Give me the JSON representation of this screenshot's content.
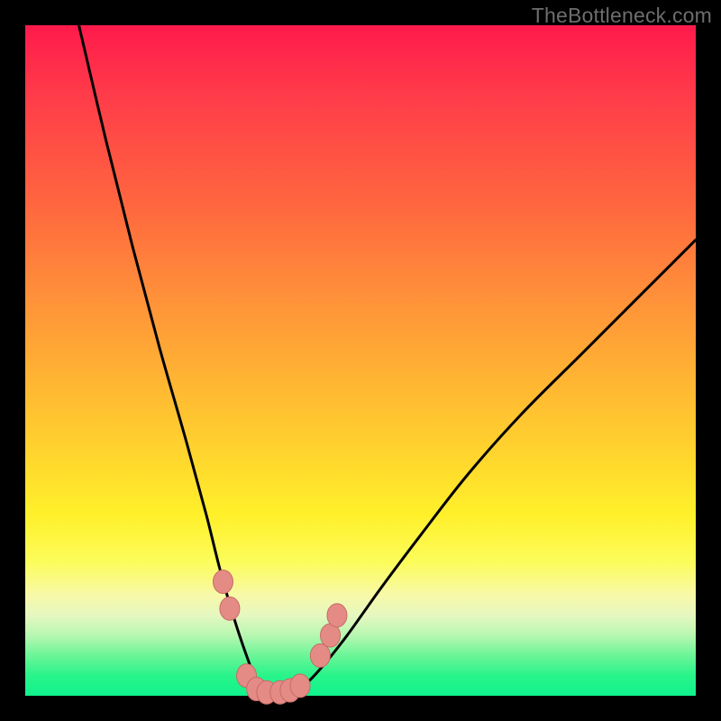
{
  "watermark": "TheBottleneck.com",
  "colors": {
    "curve_stroke": "#000000",
    "marker_fill": "#e58b86",
    "marker_stroke": "#c46c67",
    "background_black": "#000000"
  },
  "chart_data": {
    "type": "line",
    "title": "",
    "xlabel": "",
    "ylabel": "",
    "xlim": [
      0,
      100
    ],
    "ylim": [
      0,
      100
    ],
    "grid": false,
    "note": "No numeric axes or tick labels are rendered in the source image; x/y are normalized 0–100 across the plot rectangle, y measured from bottom. Curve is a V-shaped bottleneck curve with minimum near x≈35 touching y≈0; left branch rises to y≈100 near x≈8, right branch rises to y≈68 at x=100.",
    "series": [
      {
        "name": "bottleneck-curve",
        "x": [
          8,
          12,
          16,
          20,
          24,
          27,
          29,
          31,
          33,
          35,
          37,
          39,
          41,
          44,
          48,
          53,
          59,
          66,
          74,
          83,
          92,
          100
        ],
        "values": [
          100,
          83,
          67,
          52,
          38,
          27,
          19,
          12,
          6,
          1,
          0,
          0,
          1,
          4,
          9,
          16,
          24,
          33,
          42,
          51,
          60,
          68
        ]
      }
    ],
    "markers": {
      "name": "highlighted-points",
      "note": "Pink lozenge markers clustered around the trough of the curve.",
      "points": [
        {
          "x": 29.5,
          "y": 17
        },
        {
          "x": 30.5,
          "y": 13
        },
        {
          "x": 33.0,
          "y": 3
        },
        {
          "x": 34.5,
          "y": 1
        },
        {
          "x": 36.0,
          "y": 0.5
        },
        {
          "x": 38.0,
          "y": 0.5
        },
        {
          "x": 39.5,
          "y": 0.8
        },
        {
          "x": 41.0,
          "y": 1.5
        },
        {
          "x": 44.0,
          "y": 6
        },
        {
          "x": 45.5,
          "y": 9
        },
        {
          "x": 46.5,
          "y": 12
        }
      ]
    }
  }
}
